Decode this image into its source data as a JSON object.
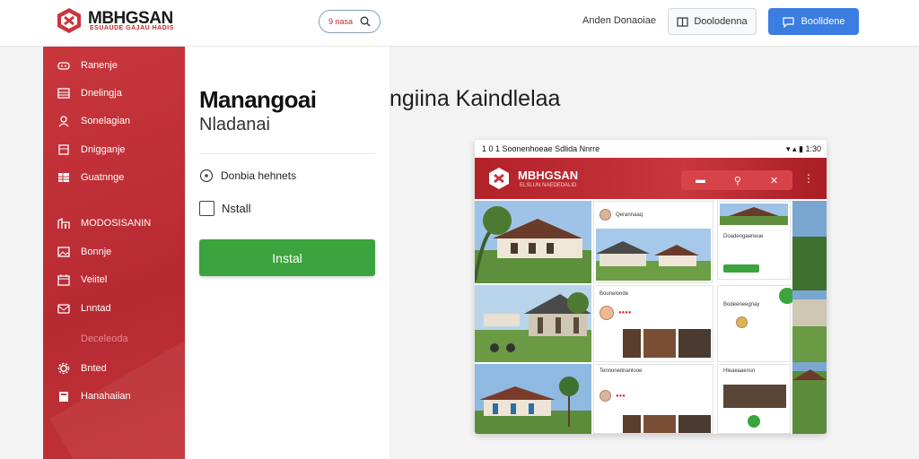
{
  "header": {
    "logo_text": "MBHGSAN",
    "logo_sub": "ESUAUDE GAJAU HADIS",
    "search_label": "9 nasa",
    "link_label": "Anden Donaoiae",
    "outline_button": "Doolodenna",
    "primary_button": "Boolldene",
    "accent": "#c9363d",
    "primary_color": "#3b7de0"
  },
  "sidebar": {
    "items": [
      {
        "label": "Ranenje",
        "icon": "gamepad-icon"
      },
      {
        "label": "Dnelingja",
        "icon": "table-icon"
      },
      {
        "label": "Sonelagian",
        "icon": "user-icon"
      },
      {
        "label": "Dnigganje",
        "icon": "box-icon"
      },
      {
        "label": "Guatnnge",
        "icon": "grid-icon"
      },
      {
        "label": "MODOSISANIN",
        "icon": "building-icon"
      },
      {
        "label": "Bonnje",
        "icon": "image-icon"
      },
      {
        "label": "Veiitel",
        "icon": "calendar-icon"
      },
      {
        "label": "Lnntad",
        "icon": "mail-icon"
      },
      {
        "label": "Deceleoda",
        "icon": ""
      },
      {
        "label": "Bnted",
        "icon": "gear-icon"
      },
      {
        "label": "Hanahaiian",
        "icon": "square-icon"
      }
    ]
  },
  "panel": {
    "title": "Manangoai",
    "subtitle": "Nladanai",
    "option_label": "Donbia hehnets",
    "checkbox_label": "Nstall",
    "install_button": "Instal",
    "install_color": "#3ba43f"
  },
  "hero": {
    "heading": "ngiina Kaindlelaa"
  },
  "device": {
    "status_left": "1 0 1   Soonenhoeae Sdlida Nnrre",
    "status_right": "▾ ▴ ▮ 1:30",
    "app_title": "MBHGSAN",
    "app_sub": "ELSLUN NAEDEDALID",
    "card_titles": [
      "Qerannaaq",
      "Bounelonde",
      "Tennoneitnanlooe"
    ],
    "card_tags": [
      "Doadengaeneue",
      "Bodeeneegnay",
      "Hleaeaaensn"
    ]
  }
}
